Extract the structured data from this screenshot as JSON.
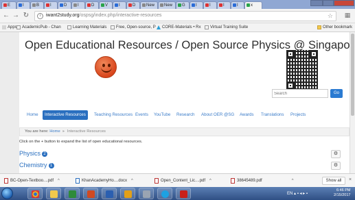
{
  "browser": {
    "tabs": [
      {
        "label": "E"
      },
      {
        "label": "I"
      },
      {
        "label": "B"
      },
      {
        "label": "I"
      },
      {
        "label": "D"
      },
      {
        "label": "I"
      },
      {
        "label": "D"
      },
      {
        "label": "V"
      },
      {
        "label": "I"
      },
      {
        "label": "D"
      },
      {
        "label": "New"
      },
      {
        "label": "New"
      },
      {
        "label": "G"
      },
      {
        "label": "I"
      },
      {
        "label": "I"
      },
      {
        "label": "I"
      },
      {
        "label": "I"
      },
      {
        "label": "x"
      }
    ],
    "url_host": "iwant2study.org",
    "url_path": "/ospsg/index.php/interactive-resources",
    "bookmarks": [
      {
        "label": "Apps"
      },
      {
        "label": "AcademicPub - Chan"
      },
      {
        "label": "Learning Materials"
      },
      {
        "label": "Free, Open-source, P"
      },
      {
        "label": "CORE-Materials • Rx"
      },
      {
        "label": "Virtual Training Suite"
      },
      {
        "label": "Other bookmark"
      }
    ]
  },
  "page": {
    "title": "Open Educational Resources / Open Source Physics @ Singapore",
    "search_placeholder": "Search",
    "go_label": "Go",
    "nav": [
      {
        "label": "Home"
      },
      {
        "label": "Interactive Resources"
      },
      {
        "label": "Teaching Resources"
      },
      {
        "label": "Events"
      },
      {
        "label": "YouTube"
      },
      {
        "label": "Research"
      },
      {
        "label": "About OER @SG"
      },
      {
        "label": "Awards"
      },
      {
        "label": "Translations"
      },
      {
        "label": "Projects"
      }
    ],
    "breadcrumb": {
      "prefix": "You are here:",
      "home": "Home",
      "current": "Interactive Resources"
    },
    "instructions": "Click on the + button to expand the list of open educational resources.",
    "sections": [
      {
        "title": "Physics",
        "badge": "2"
      },
      {
        "title": "Chemistry",
        "badge": "1"
      }
    ],
    "gear_glyph": "⚙"
  },
  "downloads": {
    "items": [
      {
        "name": "BC-Open-Textboo....pdf"
      },
      {
        "name": "KhanAcademyHo....docx"
      },
      {
        "name": "Open_Content_Lic....pdf"
      },
      {
        "name": "38645489.pdf"
      }
    ],
    "show_all_label": "Show all"
  },
  "taskbar": {
    "time": "6:46 PM",
    "date": "2/15/2017",
    "lang": "EN"
  }
}
